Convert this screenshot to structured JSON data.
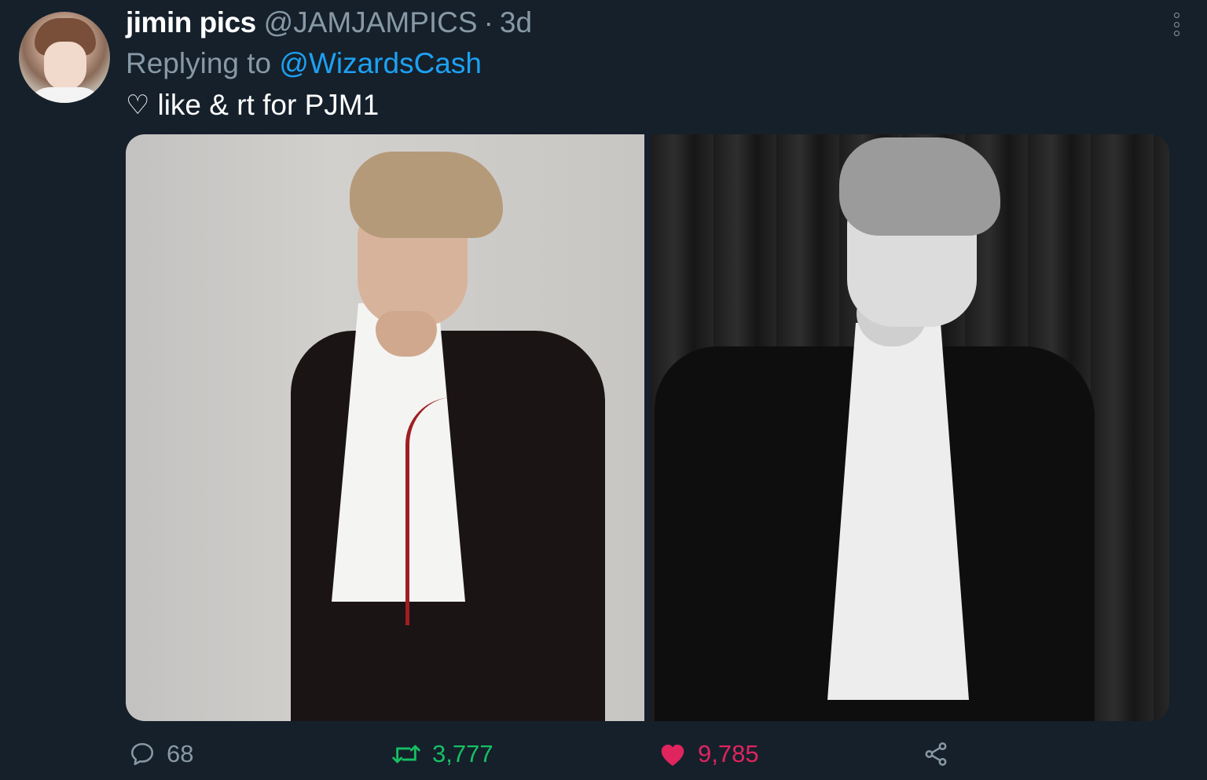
{
  "author": {
    "name": "jimin pics",
    "handle": "@JAMJAMPICS",
    "separator": "·",
    "time": "3d"
  },
  "reply": {
    "prefix": "Replying to",
    "mention": "@WizardsCash"
  },
  "body": {
    "heart_glyph": "♡",
    "text": "like & rt for PJM1"
  },
  "media": {
    "count": 2
  },
  "actions": {
    "reply_count": "68",
    "retweet_count": "3,777",
    "like_count": "9,785"
  },
  "colors": {
    "background": "#15202b",
    "muted": "#8899a6",
    "link": "#1da1f2",
    "retweet": "#17bf63",
    "like": "#e0245e"
  },
  "icons": [
    "reply-icon",
    "retweet-icon",
    "heart-icon",
    "share-icon",
    "more-options-icon"
  ]
}
